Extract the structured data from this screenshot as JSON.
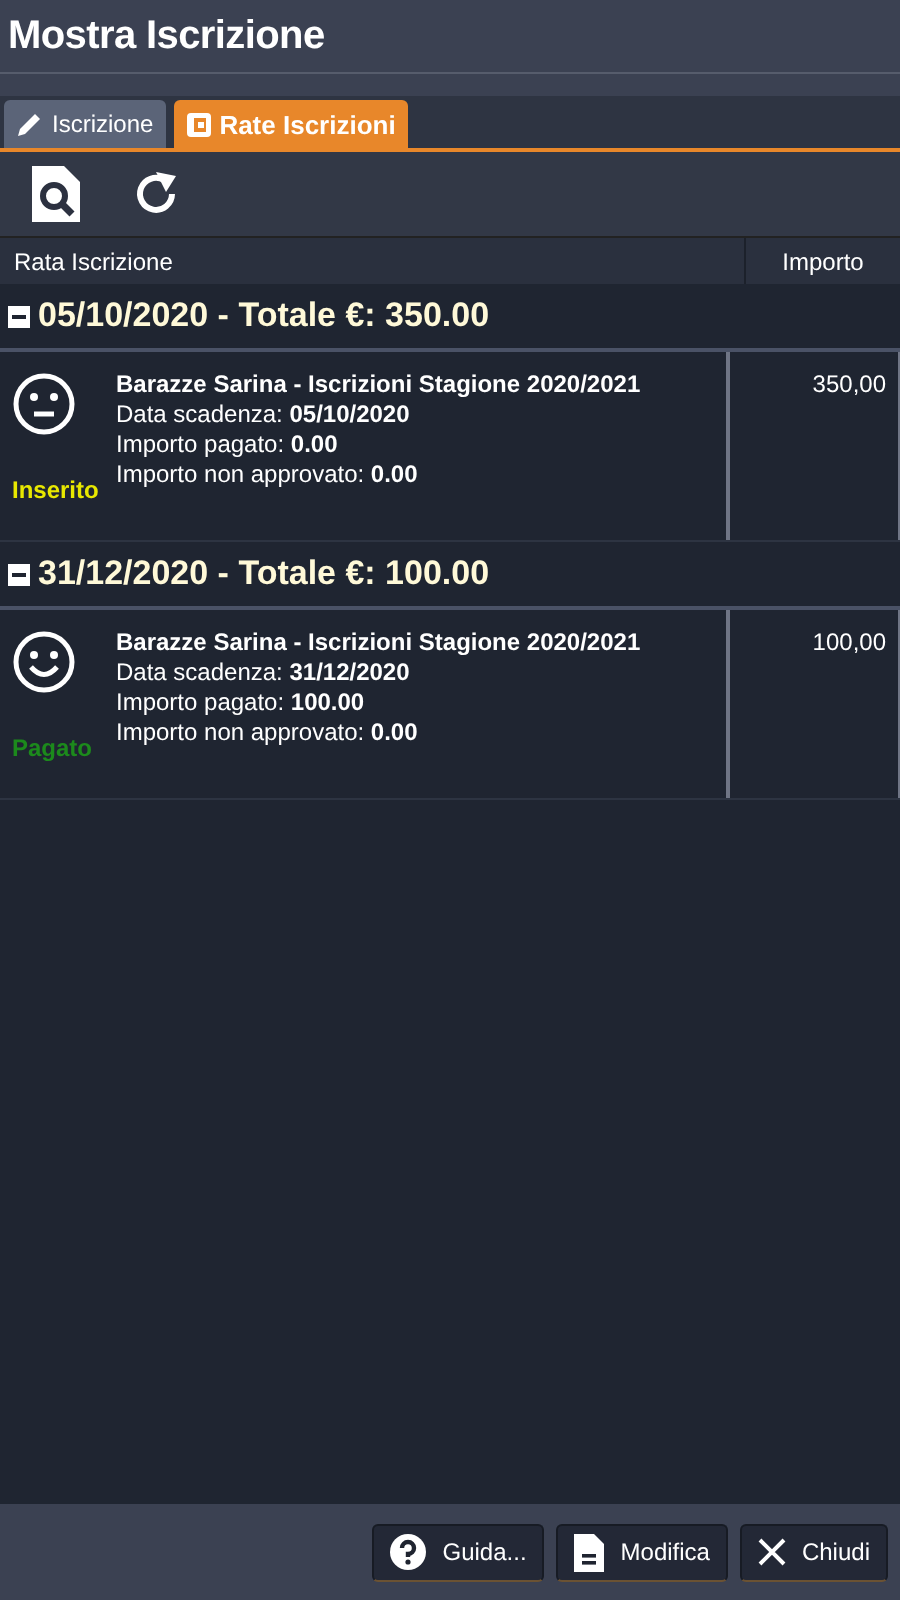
{
  "window": {
    "title": "Mostra Iscrizione"
  },
  "tabs": [
    {
      "label": "Iscrizione",
      "kind": "edit",
      "selected": false
    },
    {
      "label": "Rate Iscrizioni",
      "kind": "list",
      "selected": true
    }
  ],
  "table": {
    "columns": [
      "Rata Iscrizione",
      "Importo"
    ],
    "groups": [
      {
        "heading": "05/10/2020 - Totale €: 350.00",
        "expanded": true,
        "rows": [
          {
            "kind": "neutral",
            "title": "Barazze Sarina - Iscrizioni Stagione 2020/2021",
            "lines": [
              "Data scadenza: **05/10/2020**",
              "Importo pagato: **0.00**",
              "Importo non approvato: **0.00**"
            ],
            "status": "Inserito",
            "color": "#e8e800",
            "amount": "350,00"
          }
        ]
      },
      {
        "heading": "31/12/2020 - Totale €: 100.00",
        "expanded": true,
        "rows": [
          {
            "kind": "happy",
            "title": "Barazze Sarina - Iscrizioni Stagione 2020/2021",
            "lines": [
              "Data scadenza: **31/12/2020**",
              "Importo pagato: **100.00**",
              "Importo non approvato: **0.00**"
            ],
            "status": "Pagato",
            "color": "#1c8a1c",
            "amount": "100,00"
          }
        ]
      }
    ]
  },
  "buttons": [
    {
      "label": "Guida...",
      "kind": "help"
    },
    {
      "label": "Modifica",
      "kind": "doc"
    },
    {
      "label": "Chiudi",
      "kind": "close"
    }
  ]
}
